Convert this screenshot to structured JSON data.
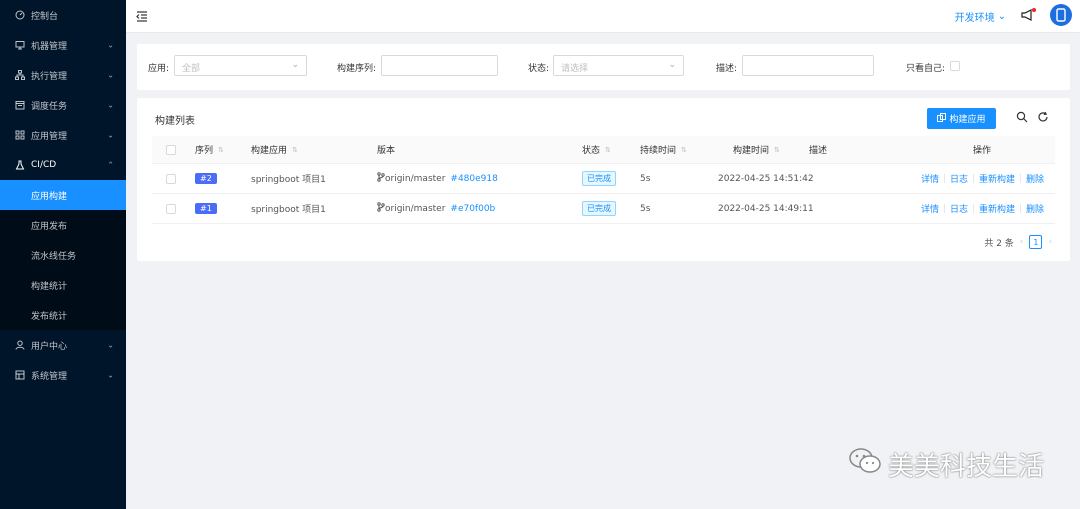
{
  "sidebar": {
    "items": [
      {
        "label": "控制台",
        "icon": "dashboard-icon"
      },
      {
        "label": "机器管理",
        "icon": "monitor-icon",
        "arrow": "⌄"
      },
      {
        "label": "执行管理",
        "icon": "sitemap-icon",
        "arrow": "⌄"
      },
      {
        "label": "调度任务",
        "icon": "calendar-icon",
        "arrow": "⌄"
      },
      {
        "label": "应用管理",
        "icon": "grid-icon",
        "arrow": "⌄"
      },
      {
        "label": "CI/CD",
        "icon": "flask-icon",
        "arrow": "⌃"
      }
    ],
    "cicd_children": [
      "应用构建",
      "应用发布",
      "流水线任务",
      "构建统计",
      "发布统计"
    ],
    "bottom_items": [
      {
        "label": "用户中心",
        "icon": "user-icon",
        "arrow": "⌄"
      },
      {
        "label": "系统管理",
        "icon": "settings-icon",
        "arrow": "⌄"
      }
    ]
  },
  "header": {
    "env": "开发环境",
    "env_arrow": "⌄"
  },
  "filters": {
    "app_label": "应用:",
    "app_placeholder": "全部",
    "seq_label": "构建序列:",
    "status_label": "状态:",
    "status_placeholder": "请选择",
    "desc_label": "描述:",
    "only_mine_label": "只看自己:"
  },
  "list": {
    "title": "构建列表",
    "build_button": "构建应用",
    "columns": [
      "序列",
      "构建应用",
      "版本",
      "状态",
      "持续时间",
      "构建时间",
      "描述",
      "操作"
    ],
    "rows": [
      {
        "seq": "#2",
        "app": "springboot 项目1",
        "branch": "origin/master",
        "commit": "#480e918",
        "status": "已完成",
        "duration": "5s",
        "time": "2022-04-25 14:51:42",
        "desc": ""
      },
      {
        "seq": "#1",
        "app": "springboot 项目1",
        "branch": "origin/master",
        "commit": "#e70f00b",
        "status": "已完成",
        "duration": "5s",
        "time": "2022-04-25 14:49:11",
        "desc": ""
      }
    ],
    "actions": [
      "详情",
      "日志",
      "重新构建",
      "删除"
    ],
    "total": "共 2 条",
    "page": "1"
  },
  "watermark": "美美科技生活",
  "colors": {
    "sidebar_bg": "#001529",
    "primary": "#1890ff",
    "tag": "#4a6cf7"
  }
}
